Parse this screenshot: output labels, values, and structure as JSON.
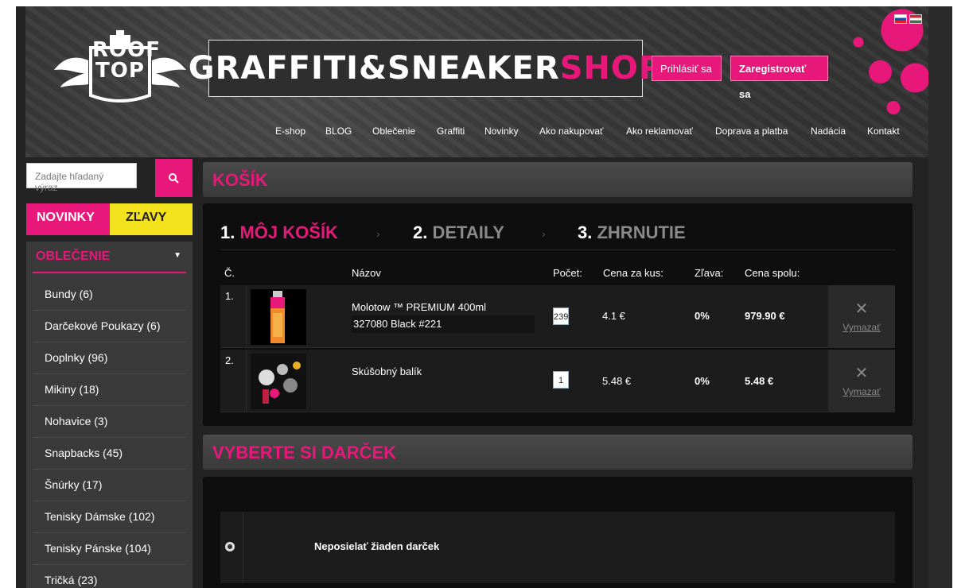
{
  "header": {
    "logo_text": "ROOF\nTOP",
    "shop_title_white": "GRAFFITI&SNEAKER",
    "shop_title_pink": "SHOP",
    "login_label": "Prihlásiť sa",
    "register_label": "Zaregistrovať sa",
    "nav": [
      "E-shop",
      "BLOG",
      "Oblečenie",
      "Graffiti",
      "Novinky",
      "Ako nakupovať",
      "Ako reklamovať",
      "Doprava a platba",
      "Nadácia",
      "Kontakt"
    ]
  },
  "sidebar": {
    "search_placeholder": "Zadajte hľadaný výraz",
    "tab_novinky": "NOVINKY",
    "tab_zlavy": "ZĽAVY",
    "category_title": "OBLEČENIE",
    "categories": [
      "Bundy (6)",
      "Darčekové Poukazy (6)",
      "Doplnky (96)",
      "Mikiny (18)",
      "Nohavice (3)",
      "Snapbacks (45)",
      "Šnúrky (17)",
      "Tenisky Dámske (102)",
      "Tenisky Pánske (104)",
      "Tričká (23)"
    ]
  },
  "cart": {
    "title": "KOŠÍK",
    "steps": [
      {
        "num": "1.",
        "label": "MÔJ KOŠÍK"
      },
      {
        "num": "2.",
        "label": "DETAILY"
      },
      {
        "num": "3.",
        "label": "ZHRNUTIE"
      }
    ],
    "step_sep": "›",
    "columns": {
      "no": "Č.",
      "name": "Názov",
      "qty": "Počet:",
      "unit": "Cena za kus:",
      "discount": "Zľava:",
      "total": "Cena spolu:"
    },
    "rows": [
      {
        "index": "1.",
        "name": "Molotow ™ PREMIUM 400ml",
        "variant": "327080 Black #221",
        "qty": "239",
        "unit": "4.1 €",
        "discount": "0%",
        "total": "979.90 €",
        "delete": "Vymazať"
      },
      {
        "index": "2.",
        "name": "Skúšobný balík",
        "variant": "",
        "qty": "1",
        "unit": "5.48 €",
        "discount": "0%",
        "total": "5.48 €",
        "delete": "Vymazať"
      }
    ]
  },
  "gift": {
    "title": "VYBERTE SI DARČEK",
    "option": "Neposielať žiaden darček"
  },
  "colors": {
    "accent": "#e8187a",
    "yellow": "#f3e21e"
  }
}
